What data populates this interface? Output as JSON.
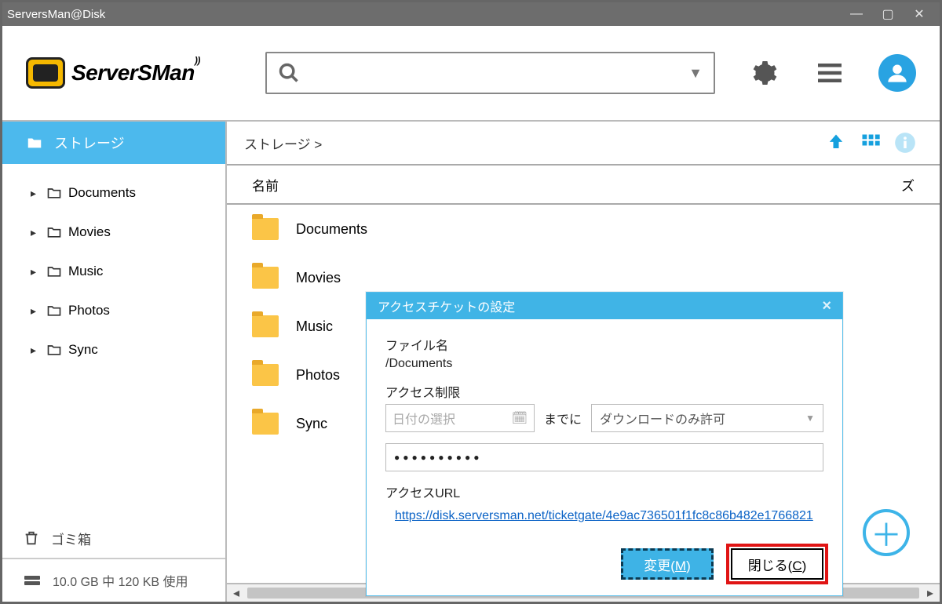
{
  "window": {
    "title": "ServersMan@Disk"
  },
  "logo_text": "ServerSMan",
  "search": {
    "placeholder": ""
  },
  "sidebar": {
    "storage_label": "ストレージ",
    "items": [
      {
        "label": "Documents"
      },
      {
        "label": "Movies"
      },
      {
        "label": "Music"
      },
      {
        "label": "Photos"
      },
      {
        "label": "Sync"
      }
    ],
    "trash_label": "ゴミ箱",
    "usage": "10.0 GB 中 120 KB 使用"
  },
  "main": {
    "breadcrumb": "ストレージ >",
    "columns": {
      "name": "名前",
      "size": "ズ"
    },
    "rows": [
      {
        "name": "Documents"
      },
      {
        "name": "Movies"
      },
      {
        "name": "Music"
      },
      {
        "name": "Photos"
      },
      {
        "name": "Sync"
      }
    ]
  },
  "dialog": {
    "title": "アクセスチケットの設定",
    "file_label": "ファイル名",
    "file_value": "/Documents",
    "access_label": "アクセス制限",
    "date_placeholder": "日付の選択",
    "until": "までに",
    "permission": "ダウンロードのみ許可",
    "password_mask": "●●●●●●●●●●",
    "url_label": "アクセスURL",
    "url": "https://disk.serversman.net/ticketgate/4e9ac736501f1fc8c86b482e1766821",
    "btn_change": "変更(M)",
    "btn_close": "閉じる(C)"
  }
}
